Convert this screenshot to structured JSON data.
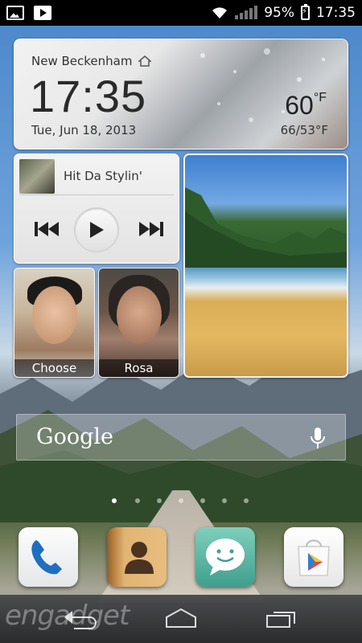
{
  "status_bar": {
    "battery_percent": "95%",
    "time": "17:35",
    "icons": [
      "image-icon",
      "play-store-icon",
      "wifi-icon",
      "signal-icon",
      "battery-icon"
    ]
  },
  "weather_widget": {
    "location": "New Beckenham",
    "time": "17:35",
    "date": "Tue, Jun 18, 2013",
    "temperature": "60",
    "unit": "°F",
    "range": "66/53°F"
  },
  "music_widget": {
    "track_title": "Hit Da Stylin'"
  },
  "contacts": [
    {
      "label": "Choose"
    },
    {
      "label": "Rosa"
    }
  ],
  "search_bar": {
    "label": "Google"
  },
  "home_pages": {
    "count": 7,
    "active_index": 0
  },
  "dock": {
    "apps": [
      "phone-icon",
      "contacts-icon",
      "messaging-icon",
      "play-store-icon"
    ]
  },
  "watermark": "engadget"
}
